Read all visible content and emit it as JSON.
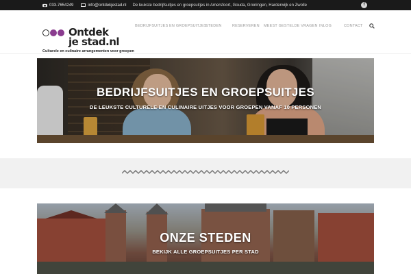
{
  "topbar": {
    "phone": "033-7654249",
    "email": "info@ontdekjestad.nl",
    "tagline": "De leukste bedrijfsuitjes en groepsuitjes in Amersfoort, Gouda, Groningen, Harderwijk en Zwolle",
    "social_icon": "facebook-icon"
  },
  "logo": {
    "line1": "Ontdek",
    "line2": "je stad.nl",
    "subtitle": "Culturele en culinaire arrangementen voor groepen"
  },
  "nav": {
    "items": [
      "BEDRIJFSUITJES EN GROEPSUITJES",
      "STEDEN",
      "RESERVEREN",
      "MEEST GESTELDE VRAGEN",
      "INLOG",
      "CONTACT"
    ],
    "search_icon": "search-icon"
  },
  "hero": {
    "title": "BEDRIJFSUITJES EN GROEPSUITJES",
    "subtitle": "DE LEUKSTE CULTURELE EN CULINAIRE UITJES VOOR GROEPEN VANAF 10 PERSONEN"
  },
  "cities": {
    "title": "ONZE STEDEN",
    "subtitle": "BEKIJK ALLE GROEPSUITJES PER STAD"
  },
  "colors": {
    "topbar": "#1a1a1a",
    "brand_purple": "#8a3c8f",
    "band": "#f1f1f1"
  }
}
